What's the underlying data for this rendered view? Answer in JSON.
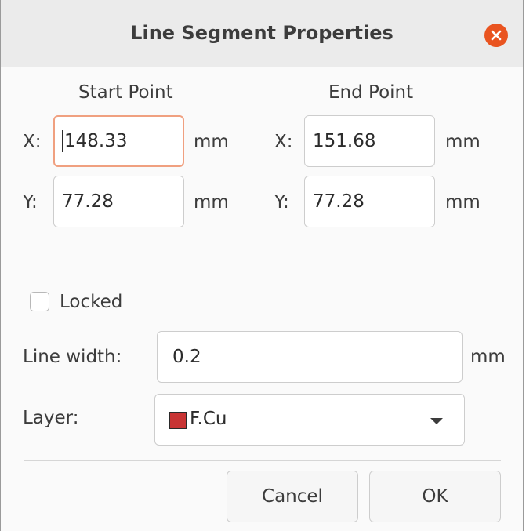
{
  "window": {
    "title": "Line Segment Properties",
    "close_icon": "close-icon"
  },
  "start_point": {
    "heading": "Start Point",
    "x_label": "X:",
    "x_value": "148.33",
    "x_unit": "mm",
    "y_label": "Y:",
    "y_value": "77.28",
    "y_unit": "mm"
  },
  "end_point": {
    "heading": "End Point",
    "x_label": "X:",
    "x_value": "151.68",
    "x_unit": "mm",
    "y_label": "Y:",
    "y_value": "77.28",
    "y_unit": "mm"
  },
  "locked": {
    "label": "Locked",
    "checked": false
  },
  "line_width": {
    "label": "Line width:",
    "value": "0.2",
    "unit": "mm"
  },
  "layer": {
    "label": "Layer:",
    "selected": "F.Cu",
    "swatch_color": "#c83434"
  },
  "buttons": {
    "cancel": "Cancel",
    "ok": "OK"
  },
  "colors": {
    "accent": "#e95420",
    "focus_border": "#f0a080"
  }
}
